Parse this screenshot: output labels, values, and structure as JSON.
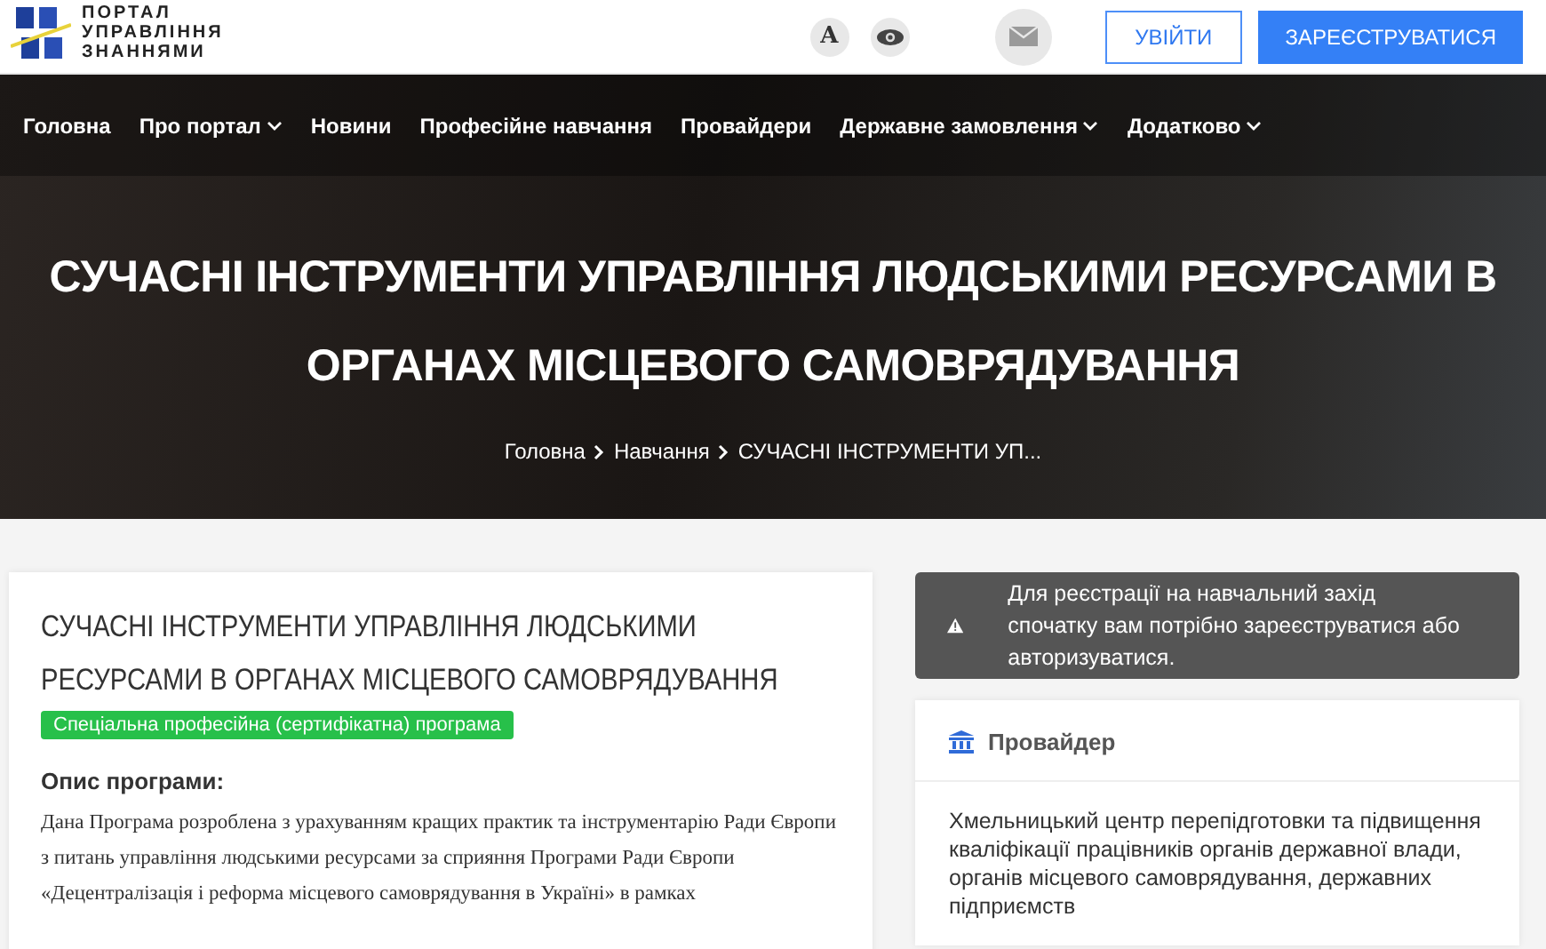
{
  "logo": {
    "lines": [
      "ПОРТАЛ",
      "УПРАВЛІННЯ",
      "ЗНАННЯМИ"
    ]
  },
  "header": {
    "font_button": "A",
    "login": "УВІЙТИ",
    "register": "ЗАРЕЄСТРУВАТИСЯ"
  },
  "nav": [
    {
      "label": "Головна",
      "dropdown": false
    },
    {
      "label": "Про портал",
      "dropdown": true
    },
    {
      "label": "Новини",
      "dropdown": false
    },
    {
      "label": "Професійне навчання",
      "dropdown": false
    },
    {
      "label": "Провайдери",
      "dropdown": false
    },
    {
      "label": "Державне замовлення",
      "dropdown": true
    },
    {
      "label": "Додатково",
      "dropdown": true
    }
  ],
  "hero": {
    "title": "СУЧАСНІ ІНСТРУМЕНТИ УПРАВЛІННЯ ЛЮДСЬКИМИ РЕСУРСАМИ В ОРГАНАХ МІСЦЕВОГО САМОВРЯДУВАННЯ",
    "breadcrumbs": [
      "Головна",
      "Навчання",
      "СУЧАСНІ ІНСТРУМЕНТИ УП..."
    ]
  },
  "course": {
    "title": "СУЧАСНІ ІНСТРУМЕНТИ УПРАВЛІННЯ ЛЮДСЬКИМИ РЕСУРСАМИ В ОРГАНАХ МІСЦЕВОГО САМОВРЯДУВАННЯ",
    "tag": "Спеціальна професійна (сертифікатна) програма",
    "description_heading": "Опис програми:",
    "description": "Дана Програма розроблена з урахуванням кращих практик та інструментарію Ради Європи з питань управління людськими ресурсами за сприяння Програми Ради Європи «Децентралізація і реформа місцевого самоврядування в Україні» в рамках"
  },
  "alert": {
    "text": "Для реєстрації на навчальний захід спочатку вам потрібно зареєструватися або авторизуватися."
  },
  "provider": {
    "heading": "Провайдер",
    "name": "Хмельницький центр перепідготовки та підвищення кваліфікації працівників органів державної влади, органів місцевого самоврядування, державних підприємств"
  }
}
